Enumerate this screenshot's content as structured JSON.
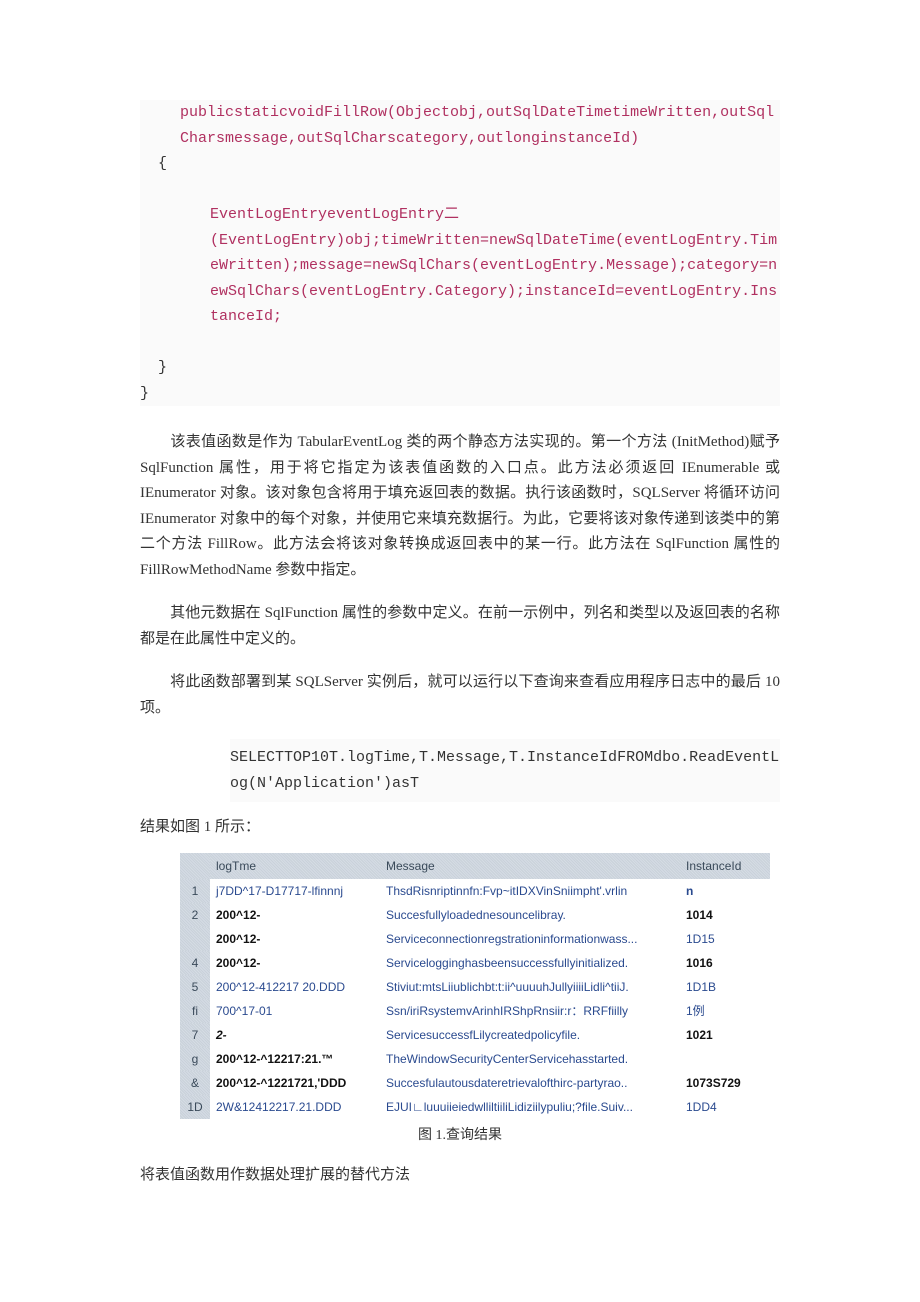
{
  "code": {
    "l1": "publicstaticvoidFillRow(Objectobj,outSqlDateTimetimeWritten,outSqlCharsmessage,outSqlCharscategory,outlonginstanceId)",
    "brace_open": "{",
    "l2": "EventLogEntryeventLogEntry二",
    "l3": "(EventLogEntry)obj;timeWritten=newSqlDateTime(eventLogEntry.TimeWritten);message=newSqlChars(eventLogEntry.Message);category=newSqlChars(eventLogEntry.Category);instanceId=eventLogEntry.InstanceId;",
    "brace_close1": "}",
    "brace_close2": "}"
  },
  "para1": "该表值函数是作为 TabularEventLog 类的两个静态方法实现的。第一个方法 (InitMethod)赋予 SqlFunction 属性，用于将它指定为该表值函数的入口点。此方法必须返回 IEnumerable 或 IEnumerator 对象。该对象包含将用于填充返回表的数据。执行该函数时，SQLServer 将循环访问 IEnumerator 对象中的每个对象，并使用它来填充数据行。为此，它要将该对象传递到该类中的第二个方法 FillRow。此方法会将该对象转换成返回表中的某一行。此方法在 SqlFunction 属性的 FillRowMethodName 参数中指定。",
  "para2": "其他元数据在 SqlFunction 属性的参数中定义。在前一示例中，列名和类型以及返回表的名称都是在此属性中定义的。",
  "para3": "将此函数部署到某 SQLServer 实例后，就可以运行以下查询来查看应用程序日志中的最后 10 项。",
  "sql": "SELECTTOP10T.logTime,T.Message,T.InstanceIdFROMdbo.ReadEventLog(N'Application')asT",
  "result_label": "结果如图 1 所示：",
  "table": {
    "headers": {
      "h1": "",
      "h2": "logTme",
      "h3": "Message",
      "h4": "InstanceId"
    },
    "rows": [
      {
        "n": "1",
        "t": "j7DD^17-D17717-lfinnnj",
        "t_style": "normal",
        "m": "ThsdRisnriptinnfn:Fvp~itIDXVinSniimpht'.vrlin",
        "i": "n",
        "i_style": "bold-blue"
      },
      {
        "n": "2",
        "t": "200^12-",
        "t_style": "bold",
        "m": "Succesfullyloadednesouncelibray.",
        "i": "1014",
        "i_style": "bold"
      },
      {
        "n": "",
        "t": "200^12-",
        "t_style": "bold",
        "m": "Serviceconnectionregstrationinformationwass...",
        "i": "1D15",
        "i_style": "normal"
      },
      {
        "n": "4",
        "t": "200^12-",
        "t_style": "bold",
        "m": "Servicelogginghasbeensuccessfullyinitialized.",
        "i": "1016",
        "i_style": "bold"
      },
      {
        "n": "5",
        "t": "200^12-412217 20.DDD",
        "t_style": "normal",
        "m": "Stiviut:mtsLiiublichbt:t:ii^uuuuhJullyiiiiLidli^tiiJ.",
        "i": "1D1B",
        "i_style": "normal"
      },
      {
        "n": "fi",
        "t": "700^17-01",
        "t_style": "normal",
        "m": "Ssn/iriRsystemvArinhIRShpRnsiir:r：RRFfiilly",
        "i": "1例",
        "i_style": "normal"
      },
      {
        "n": "7",
        "t": "2-",
        "t_style": "boldital",
        "m": "ServicesuccessfLilycreatedpolicyfile.",
        "i": "1021",
        "i_style": "bold"
      },
      {
        "n": "g",
        "t": "200^12-^12217:21.™",
        "t_style": "bold",
        "m": "TheWindowSecurityCenterServicehasstarted.",
        "i": "",
        "i_style": "normal"
      },
      {
        "n": "&",
        "t": "200^12-^1221721,'DDD",
        "t_style": "bold",
        "m": "Succesfulautousdateretrievalofthirc-partyrao..",
        "i": "1073S729",
        "i_style": "bold"
      },
      {
        "n": "1D",
        "t": "2W&12412217.21.DDD",
        "t_style": "normal",
        "m": "EJUI∟luuuiieiedwlliltiiliLidiziilypuliu;?file.Suiv...",
        "i": "1DD4",
        "i_style": "normal"
      }
    ]
  },
  "figure_caption": "图 1.查询结果",
  "section_sub": "将表值函数用作数据处理扩展的替代方法"
}
